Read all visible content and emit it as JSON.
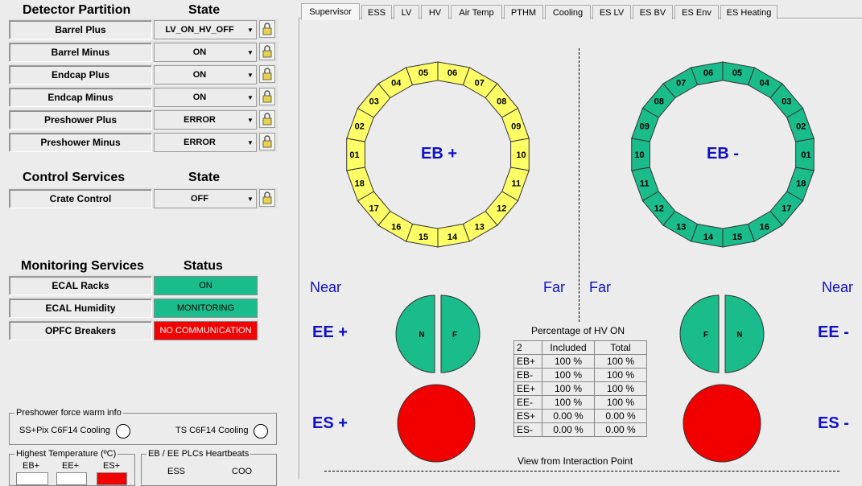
{
  "detector_partition": {
    "header": "Detector Partition",
    "state_header": "State",
    "rows": [
      {
        "label": "Barrel Plus",
        "state": "LV_ON_HV_OFF"
      },
      {
        "label": "Barrel Minus",
        "state": "ON"
      },
      {
        "label": "Endcap Plus",
        "state": "ON"
      },
      {
        "label": "Endcap Minus",
        "state": "ON"
      },
      {
        "label": "Preshower Plus",
        "state": "ERROR"
      },
      {
        "label": "Preshower Minus",
        "state": "ERROR"
      }
    ]
  },
  "control_services": {
    "header": "Control Services",
    "state_header": "State",
    "rows": [
      {
        "label": "Crate Control",
        "state": "OFF"
      }
    ]
  },
  "monitoring_services": {
    "header": "Monitoring Services",
    "status_header": "Status",
    "rows": [
      {
        "label": "ECAL Racks",
        "status": "ON",
        "color": "#1abc8c"
      },
      {
        "label": "ECAL Humidity",
        "status": "MONITORING",
        "color": "#1abc8c"
      },
      {
        "label": "OPFC Breakers",
        "status": "NO COMMUNICATION",
        "color": "#f20000"
      }
    ]
  },
  "preshower_warm": {
    "legend": "Preshower force warm info",
    "ss_label": "SS+Pix C6F14 Cooling",
    "ts_label": "TS C6F14 Cooling"
  },
  "highest_temp": {
    "legend": "Highest Temperature (ºC)",
    "cols": [
      "EB+",
      "EE+",
      "ES+"
    ]
  },
  "heartbeats": {
    "legend": "EB / EE PLCs Heartbeats",
    "cols": [
      "ESS",
      "COO"
    ]
  },
  "tabs": [
    "Supervisor",
    "ESS",
    "LV",
    "HV",
    "Air Temp",
    "PTHM",
    "Cooling",
    "ES LV",
    "ES BV",
    "ES Env",
    "ES Heating"
  ],
  "active_tab": "Supervisor",
  "barrel_plus": {
    "label": "EB +",
    "color": "#ffff66"
  },
  "barrel_minus": {
    "label": "EB -",
    "color": "#1abc8c"
  },
  "sm_labels": [
    "01",
    "02",
    "03",
    "04",
    "05",
    "06",
    "07",
    "08",
    "09",
    "10",
    "11",
    "12",
    "13",
    "14",
    "15",
    "16",
    "17",
    "18"
  ],
  "near_left": "Near",
  "far_left": "Far",
  "far_right": "Far",
  "near_right": "Near",
  "ee_plus": {
    "label": "EE +",
    "left": "N",
    "right": "F",
    "color": "#1abc8c"
  },
  "ee_minus": {
    "label": "EE -",
    "left": "F",
    "right": "N",
    "color": "#1abc8c"
  },
  "es_plus": {
    "label": "ES +",
    "color": "#f20000"
  },
  "es_minus": {
    "label": "ES -",
    "color": "#f20000"
  },
  "hv_table": {
    "title": "Percentage of HV ON",
    "headers": [
      "2",
      "Included",
      "Total"
    ],
    "rows": [
      [
        "EB+",
        "100 %",
        "100 %"
      ],
      [
        "EB-",
        "100 %",
        "100 %"
      ],
      [
        "EE+",
        "100 %",
        "100 %"
      ],
      [
        "EE-",
        "100 %",
        "100 %"
      ],
      [
        "ES+",
        "0.00 %",
        "0.00 %"
      ],
      [
        "ES-",
        "0.00 %",
        "0.00 %"
      ]
    ]
  },
  "view_caption": "View from Interaction Point"
}
